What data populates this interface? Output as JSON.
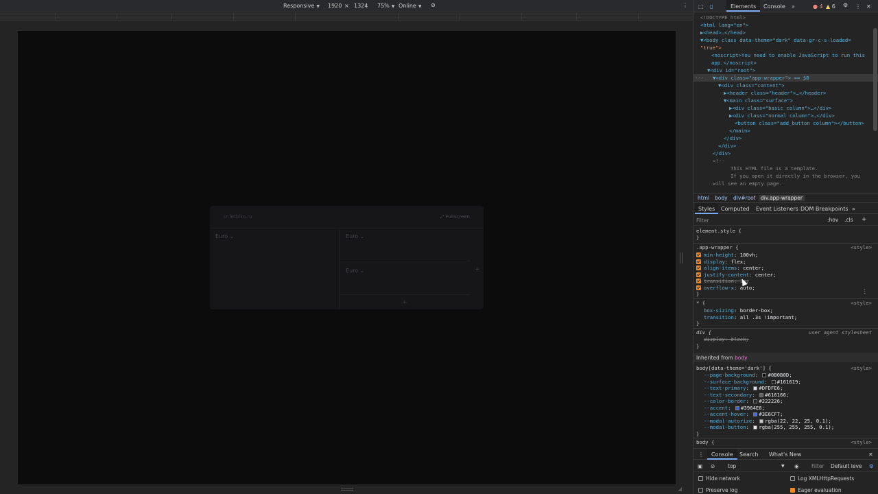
{
  "device_toolbar": {
    "mode": "Responsive",
    "width": "1920",
    "times": "×",
    "height": "1324",
    "zoom": "75%",
    "network": "Online"
  },
  "app": {
    "domain": "cr.fetbiko.ru",
    "fullscreen_label": "Fullscreen",
    "column_labels": [
      "Euro",
      "Euro",
      "Euro"
    ],
    "add_symbol": "+"
  },
  "devtools": {
    "tabs": [
      "Elements",
      "Console"
    ],
    "more": "»",
    "error_count": "4",
    "warning_count": "6",
    "dom_lines": [
      "<!DOCTYPE html>",
      "<html lang=\"en\">",
      "▶<head>…</head>",
      "▼<body class data-theme=\"dark\" data-gr-c-s-loaded=",
      "\"true\">",
      "<noscript>You need to enable JavaScript to run this",
      "app.</noscript>",
      "▼<div id=\"root\">",
      "▼<div class=\"app-wrapper\"> == $0",
      "▼<div class=\"content\">",
      "▶<header class=\"header\">…</header>",
      "▼<main class=\"surface\">",
      "▶<div class=\"basic column\">…</div>",
      "▶<div class=\"normal column\">…</div>",
      "<button class=\"add_button column\"></button>",
      "</main>",
      "</div>",
      "</div>",
      "</div>",
      "<!--",
      "This HTML file is a template.",
      "If you open it directly in the browser, you",
      "will see an empty page."
    ],
    "breadcrumbs": [
      "html",
      "body",
      "div#root",
      "div.app-wrapper"
    ],
    "style_tabs": [
      "Styles",
      "Computed",
      "Event Listeners",
      "DOM Breakpoints",
      "»"
    ],
    "filter_placeholder": "Filter",
    "hov": ":hov",
    "cls": ".cls",
    "plus": "+",
    "element_style": "element.style {",
    "close_brace": "}",
    "app_wrapper_rule": {
      "selector": ".app-wrapper {",
      "source": "<style>",
      "props": [
        {
          "name": "min-height",
          "value": "100vh;"
        },
        {
          "name": "display",
          "value": "flex;"
        },
        {
          "name": "align-items",
          "value": "center;"
        },
        {
          "name": "justify-content",
          "value": "center;"
        },
        {
          "name": "transition",
          "value": "1s;"
        },
        {
          "name": "overflow-x",
          "value": "auto;"
        }
      ]
    },
    "star_rule": {
      "selector": "* {",
      "source": "<style>",
      "props": [
        {
          "name": "box-sizing",
          "value": "border-box;"
        },
        {
          "name": "transition",
          "value": "all .3s !important;"
        }
      ]
    },
    "div_rule": {
      "selector": "div {",
      "source": "user agent stylesheet",
      "prop": "display: block;"
    },
    "inherited_label": "Inherited from",
    "inherited_from": "body",
    "body_rule": {
      "selector": "body[data-theme='dark'] {",
      "source": "<style>",
      "vars": [
        {
          "name": "--page-background",
          "value": "#0B0B0D;",
          "color": "#0B0B0D"
        },
        {
          "name": "--surface-background",
          "value": "#161619;",
          "color": "#161619"
        },
        {
          "name": "--text-primary",
          "value": "#DFDFE6;",
          "color": "#DFDFE6"
        },
        {
          "name": "--text-secondary",
          "value": "#616166;",
          "color": "#616166"
        },
        {
          "name": "--color-border",
          "value": "#222226;",
          "color": "#222226"
        },
        {
          "name": "--accent",
          "value": "#3964E6;",
          "color": "#3964E6"
        },
        {
          "name": "--accent-hover",
          "value": "#3E6CF7;",
          "color": "#3E6CF7"
        },
        {
          "name": "--modal-autorize",
          "value": "rgba(22, 22, 25, 0.1);",
          "color": "#c9c9cc"
        },
        {
          "name": "--modal-button",
          "value": "rgba(255, 255, 255, 0.1);",
          "color": "#e8e8e8"
        }
      ]
    },
    "body_rule2": "body {",
    "body_rule2_source": "<style>",
    "drawer_tabs": [
      "Console",
      "Search",
      "What's New"
    ],
    "console_context": "top",
    "console_filter": "Filter",
    "console_level": "Default leve",
    "options": [
      {
        "label": "Hide network",
        "checked": false
      },
      {
        "label": "Log XMLHttpRequests",
        "checked": false
      },
      {
        "label": "Preserve log",
        "checked": false
      },
      {
        "label": "Eager evaluation",
        "checked": true
      }
    ]
  }
}
